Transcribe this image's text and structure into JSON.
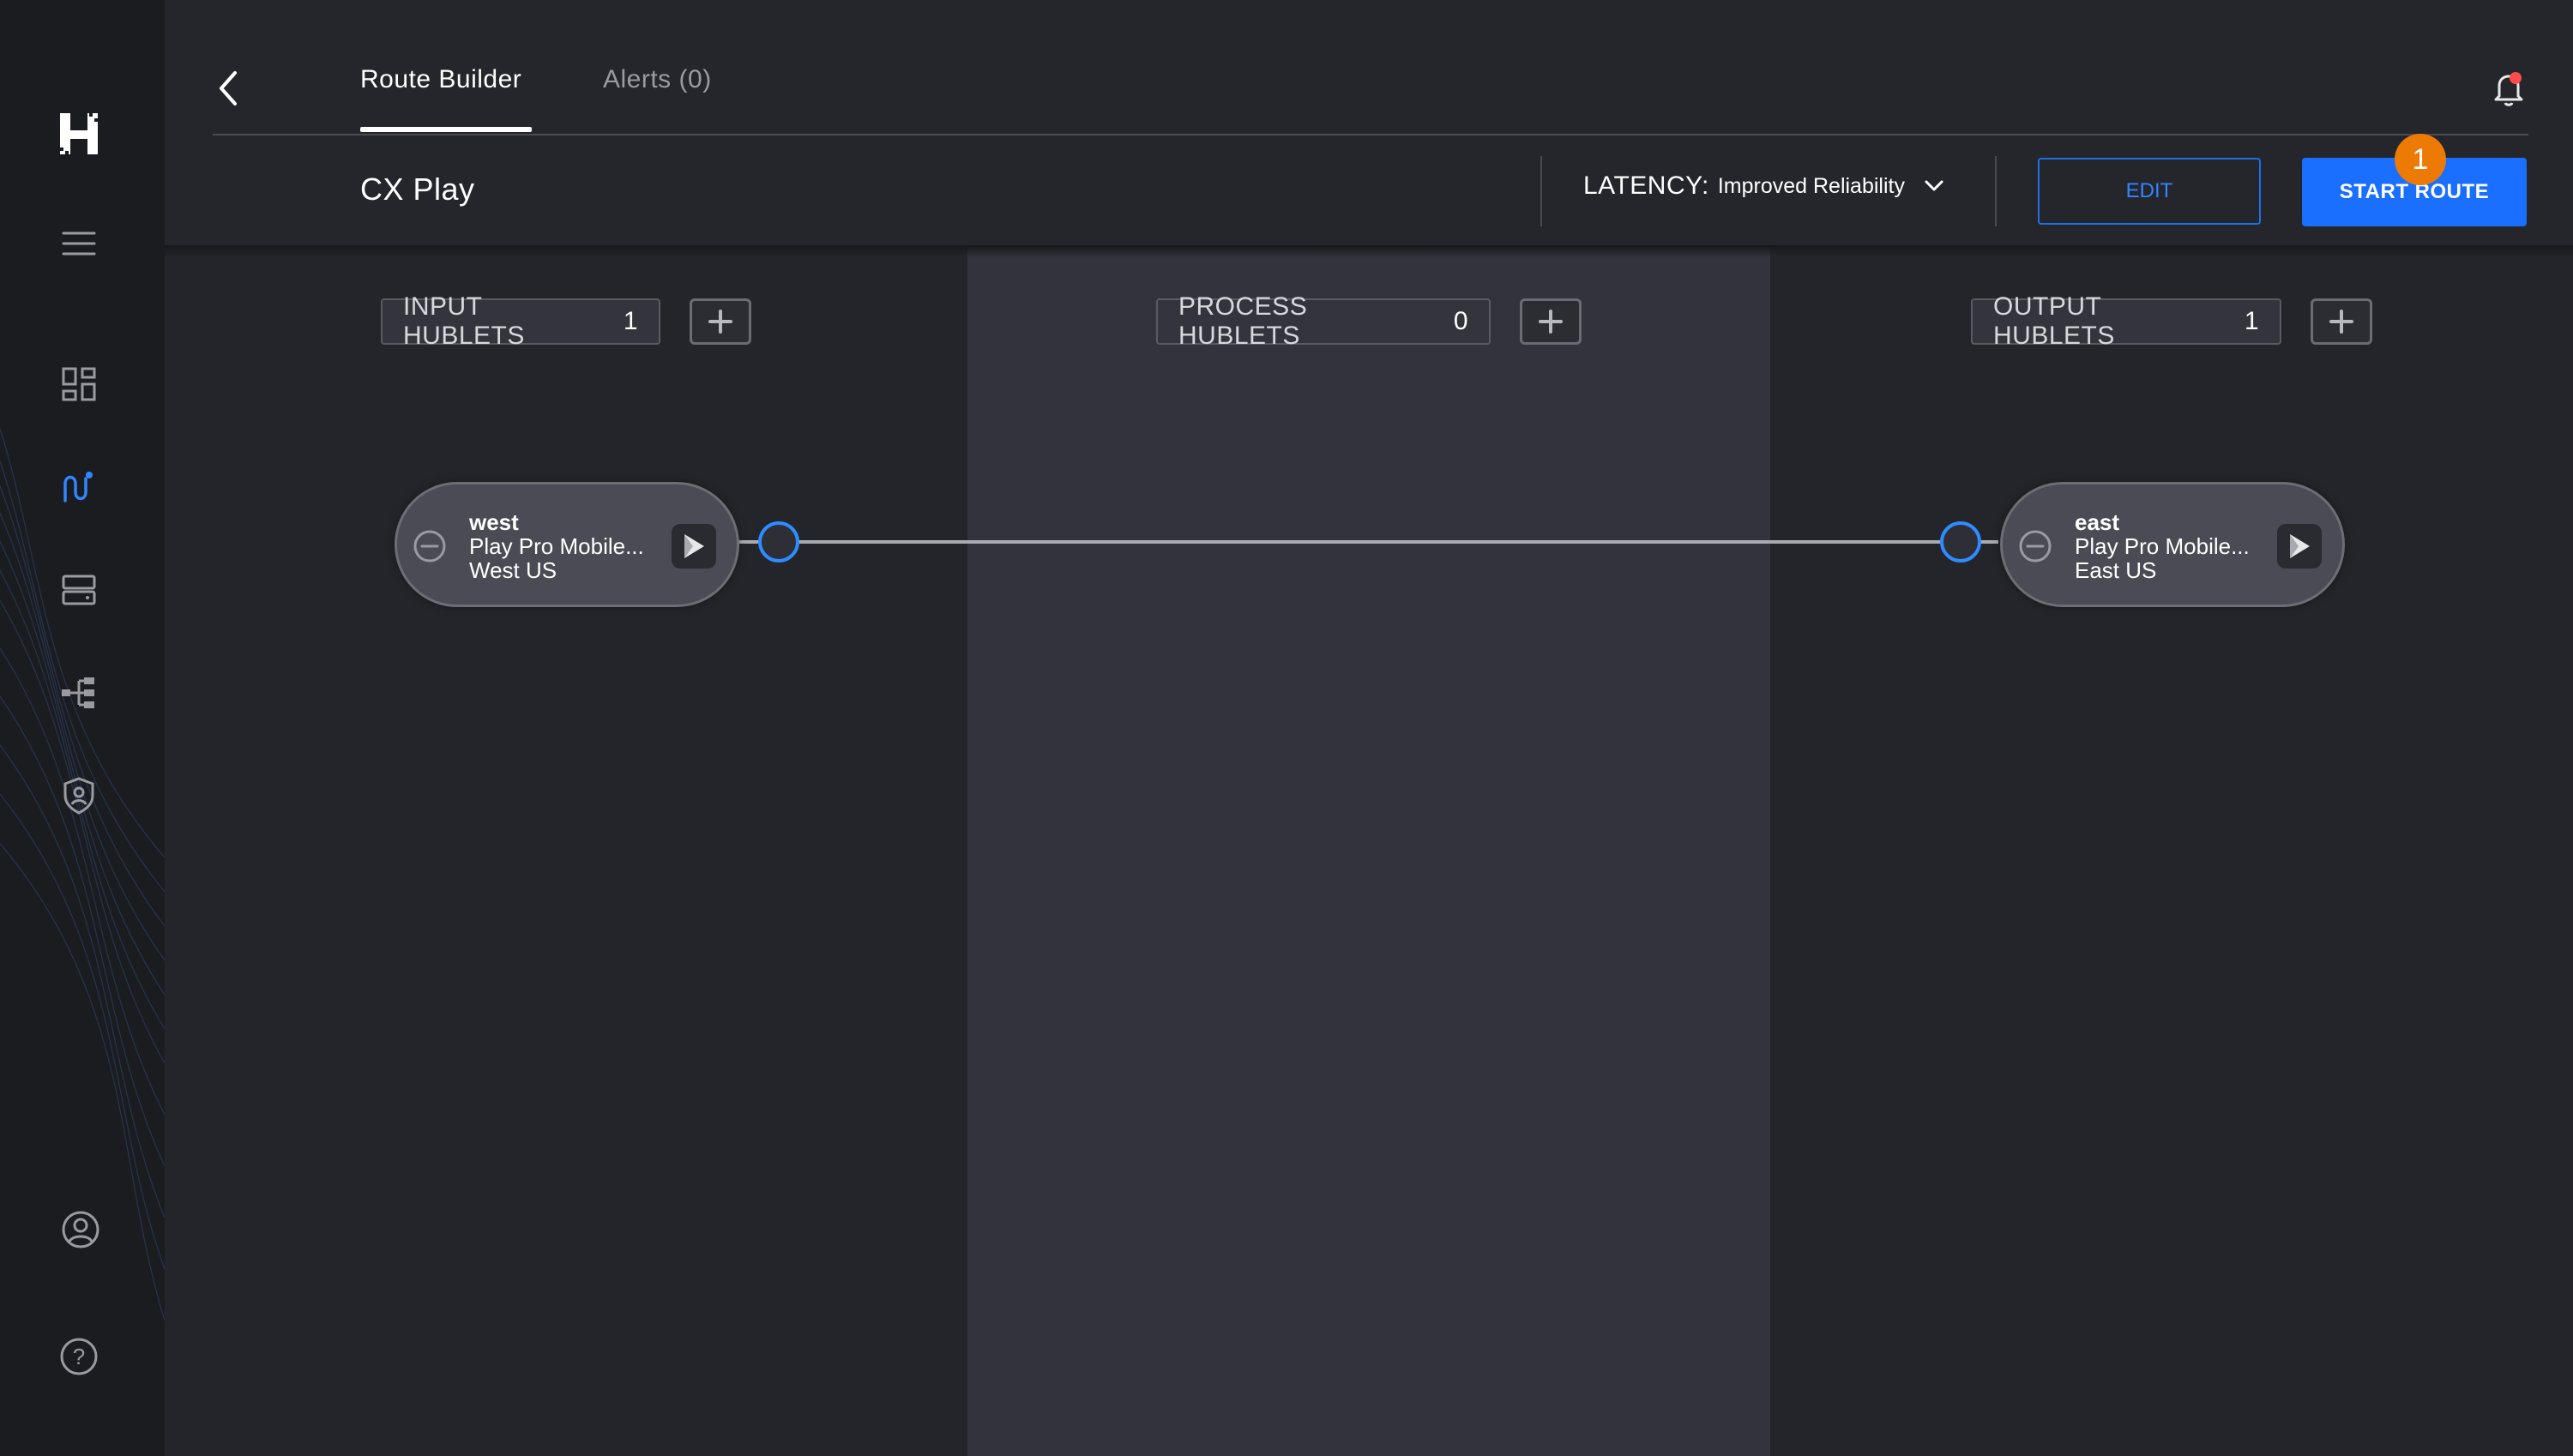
{
  "app": {
    "logo_letter": "H",
    "colors": {
      "accent": "#1a6fff",
      "badge": "#ee7a06",
      "port": "#2d8cff",
      "notification_dot": "#ff4b4b"
    }
  },
  "sidebar": {
    "items": [
      {
        "icon": "menu-icon"
      },
      {
        "icon": "dashboard-icon"
      },
      {
        "icon": "routes-icon",
        "active": true
      },
      {
        "icon": "servers-icon"
      },
      {
        "icon": "topology-icon"
      },
      {
        "icon": "security-shield-icon"
      },
      {
        "icon": "user-profile-icon"
      },
      {
        "icon": "help-icon"
      }
    ]
  },
  "header": {
    "tabs": [
      {
        "label": "Route Builder",
        "active": true
      },
      {
        "label": "Alerts (0)",
        "active": false
      }
    ],
    "route_name": "CX Play",
    "latency": {
      "label": "LATENCY:",
      "value": "Improved Reliability"
    },
    "edit_label": "EDIT",
    "start_label": "START ROUTE",
    "badge_count": "1"
  },
  "columns": {
    "input": {
      "label": "INPUT HUBLETS",
      "count": "1"
    },
    "process": {
      "label": "PROCESS HUBLETS",
      "count": "0"
    },
    "output": {
      "label": "OUTPUT HUBLETS",
      "count": "1"
    }
  },
  "nodes": {
    "input": {
      "name": "west",
      "device": "Play Pro Mobile...",
      "region": "West US"
    },
    "output": {
      "name": "east",
      "device": "Play Pro Mobile...",
      "region": "East US"
    }
  }
}
